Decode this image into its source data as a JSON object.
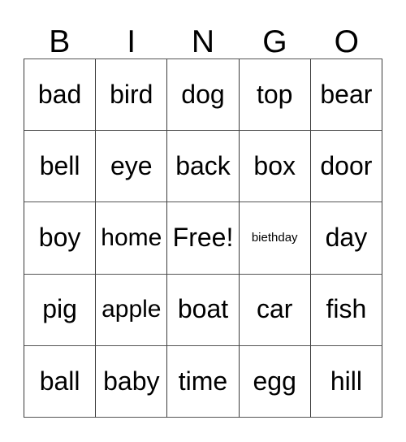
{
  "card": {
    "headers": [
      "B",
      "I",
      "N",
      "G",
      "O"
    ],
    "rows": [
      [
        {
          "text": "bad",
          "size": "normal"
        },
        {
          "text": "bird",
          "size": "normal"
        },
        {
          "text": "dog",
          "size": "normal"
        },
        {
          "text": "top",
          "size": "normal"
        },
        {
          "text": "bear",
          "size": "normal"
        }
      ],
      [
        {
          "text": "bell",
          "size": "normal"
        },
        {
          "text": "eye",
          "size": "normal"
        },
        {
          "text": "back",
          "size": "normal"
        },
        {
          "text": "box",
          "size": "normal"
        },
        {
          "text": "door",
          "size": "normal"
        }
      ],
      [
        {
          "text": "boy",
          "size": "normal"
        },
        {
          "text": "home",
          "size": "small"
        },
        {
          "text": "Free!",
          "size": "normal"
        },
        {
          "text": "biethday",
          "size": "tiny"
        },
        {
          "text": "day",
          "size": "normal"
        }
      ],
      [
        {
          "text": "pig",
          "size": "normal"
        },
        {
          "text": "apple",
          "size": "small"
        },
        {
          "text": "boat",
          "size": "normal"
        },
        {
          "text": "car",
          "size": "normal"
        },
        {
          "text": "fish",
          "size": "normal"
        }
      ],
      [
        {
          "text": "ball",
          "size": "normal"
        },
        {
          "text": "baby",
          "size": "normal"
        },
        {
          "text": "time",
          "size": "normal"
        },
        {
          "text": "egg",
          "size": "normal"
        },
        {
          "text": "hill",
          "size": "normal"
        }
      ]
    ],
    "free_space": {
      "row": 2,
      "column": 2,
      "label": "Free!"
    },
    "colors": {
      "background": "#ffffff",
      "text": "#000000",
      "grid_line": "#3a3a3a",
      "grid_line_light": "#555555"
    }
  }
}
